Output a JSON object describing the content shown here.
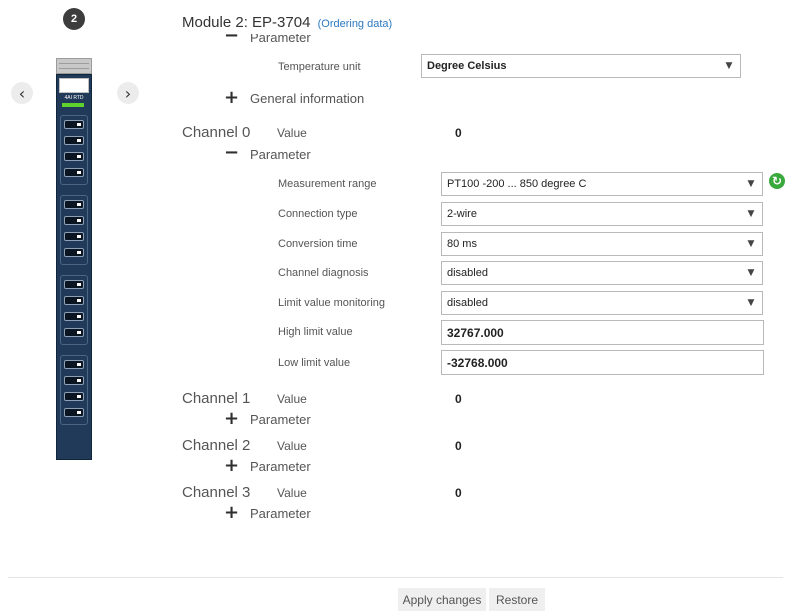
{
  "device": {
    "badge": "2",
    "prev_icon": "chevron-left-icon",
    "next_icon": "chevron-right-icon",
    "module_text": "4AI RTD"
  },
  "header": {
    "title": "Module 2: EP-3704",
    "link": "(Ordering data)"
  },
  "module_params": {
    "parameter_label": "Parameter",
    "temperature_unit": {
      "label": "Temperature unit",
      "value": "Degree Celsius"
    },
    "general_info_label": "General information"
  },
  "channels": [
    {
      "title": "Channel 0",
      "value_label": "Value",
      "value": "0",
      "parameter_label": "Parameter",
      "fields": {
        "measurement_range": {
          "label": "Measurement range",
          "value": "PT100 -200 ... 850 degree C"
        },
        "connection_type": {
          "label": "Connection type",
          "value": "2-wire"
        },
        "conversion_time": {
          "label": "Conversion time",
          "value": "80 ms"
        },
        "channel_diagnosis": {
          "label": "Channel diagnosis",
          "value": "disabled"
        },
        "limit_value_monitoring": {
          "label": "Limit value monitoring",
          "value": "disabled"
        },
        "high_limit": {
          "label": "High limit value",
          "value": "32767.000"
        },
        "low_limit": {
          "label": "Low limit value",
          "value": "-32768.000"
        }
      }
    },
    {
      "title": "Channel 1",
      "value_label": "Value",
      "value": "0",
      "parameter_label": "Parameter"
    },
    {
      "title": "Channel 2",
      "value_label": "Value",
      "value": "0",
      "parameter_label": "Parameter"
    },
    {
      "title": "Channel 3",
      "value_label": "Value",
      "value": "0",
      "parameter_label": "Parameter"
    }
  ],
  "footer": {
    "apply_label": "Apply changes",
    "restore_label": "Restore"
  },
  "colors": {
    "accent_link": "#2b7ac0",
    "refresh_green": "#39a93d",
    "module_blue": "#213a59",
    "led_green": "#5dd32c"
  }
}
